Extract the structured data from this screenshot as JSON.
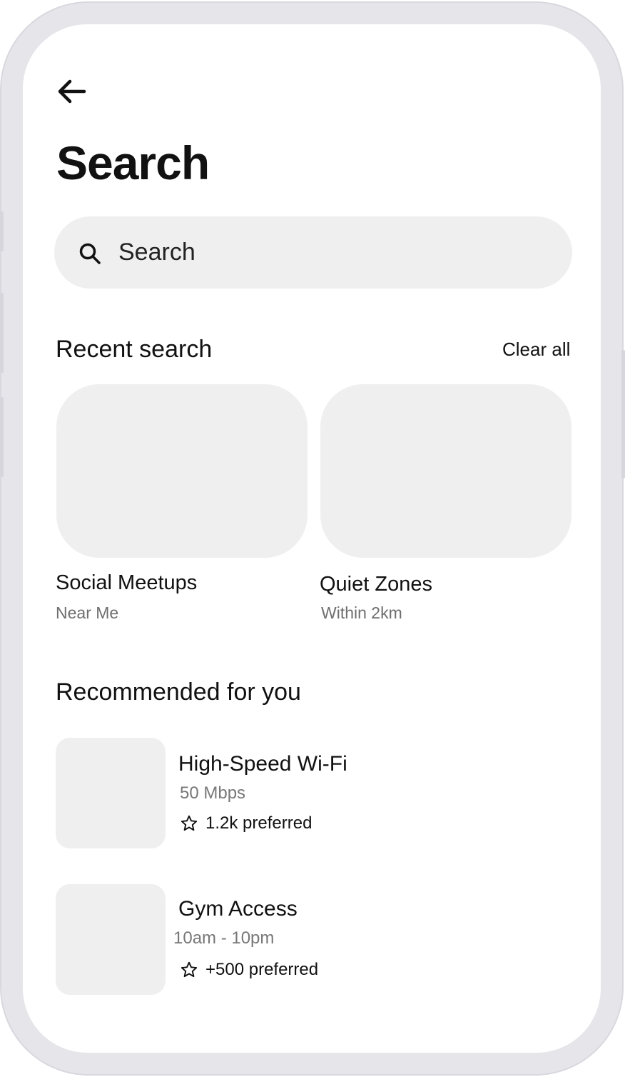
{
  "header": {
    "back_icon": "arrow-left-icon",
    "title": "Search"
  },
  "search": {
    "icon": "search-icon",
    "placeholder": "Search"
  },
  "recent": {
    "title": "Recent search",
    "clear_label": "Clear all",
    "items": [
      {
        "title": "Social Meetups",
        "subtitle": "Near Me"
      },
      {
        "title": "Quiet Zones",
        "subtitle": "Within 2km"
      }
    ]
  },
  "recommended": {
    "title": "Recommended for you",
    "items": [
      {
        "title": "High-Speed Wi-Fi",
        "detail": "50 Mbps",
        "preferred": "1.2k preferred",
        "icon": "star-outline-icon"
      },
      {
        "title": "Gym Access",
        "detail": "10am - 10pm",
        "preferred": "+500 preferred",
        "icon": "star-outline-icon"
      }
    ]
  },
  "colors": {
    "frame": "#e5e5ea",
    "placeholder_fill": "#efefef",
    "text_primary": "#111111",
    "text_secondary": "#6e6e6e"
  }
}
